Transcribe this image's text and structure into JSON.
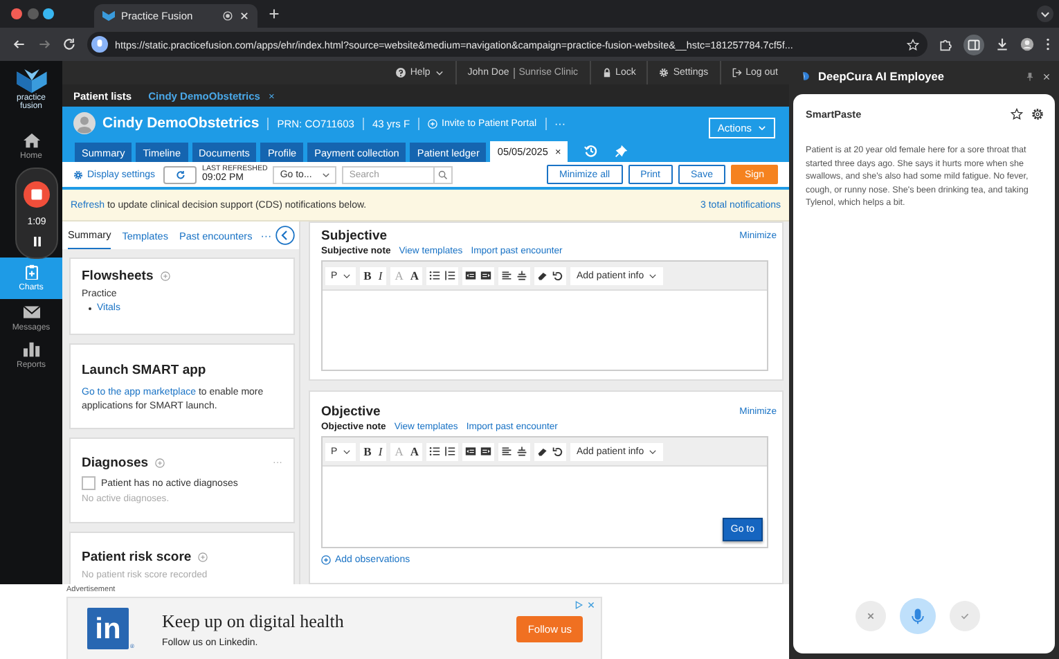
{
  "browser": {
    "tab_title": "Practice Fusion",
    "url": "https://static.practicefusion.com/apps/ehr/index.html?source=website&medium=navigation&campaign=practice-fusion-website&__hstc=181257784.7cf5f..."
  },
  "nav": {
    "logo_text": "practice fusion",
    "items": [
      {
        "label": "Home",
        "selected": false
      },
      {
        "label": "Charts",
        "selected": true
      },
      {
        "label": "Messages",
        "selected": false
      },
      {
        "label": "Reports",
        "selected": false
      }
    ]
  },
  "recorder": {
    "time": "1:09"
  },
  "topbar": {
    "help": "Help",
    "user": "John Doe",
    "clinic": "Sunrise Clinic",
    "lock": "Lock",
    "settings": "Settings",
    "logout": "Log out"
  },
  "patient_tabs": [
    {
      "label": "Patient lists",
      "selected": false
    },
    {
      "label": "Cindy DemoObstetrics",
      "selected": true,
      "close": "×"
    }
  ],
  "patient": {
    "name": "Cindy DemoObstetrics",
    "prn": "PRN: CO711603",
    "age": "43 yrs F",
    "invite": "Invite to Patient Portal",
    "more": "···",
    "actions": "Actions"
  },
  "chart_tabs": [
    {
      "label": "Summary",
      "selected": false
    },
    {
      "label": "Timeline",
      "selected": false
    },
    {
      "label": "Documents",
      "selected": false
    },
    {
      "label": "Profile",
      "selected": false
    },
    {
      "label": "Payment collection",
      "selected": false
    },
    {
      "label": "Patient ledger",
      "selected": false
    },
    {
      "label": "05/05/2025",
      "selected": true,
      "close": "×"
    }
  ],
  "toolbar": {
    "display_settings": "Display settings",
    "last_refreshed_label": "LAST REFRESHED",
    "last_refreshed_time": "09:02 PM",
    "goto": "Go to...",
    "search_placeholder": "Search",
    "buttons": [
      {
        "label": "Minimize all",
        "kind": "outline"
      },
      {
        "label": "Print",
        "kind": "outline"
      },
      {
        "label": "Save",
        "kind": "outline"
      },
      {
        "label": "Sign",
        "kind": "primary"
      }
    ]
  },
  "notification": {
    "link": "Refresh",
    "text": "to update clinical decision support (CDS) notifications below.",
    "count": "3 total notifications"
  },
  "side_tabs": [
    {
      "label": "Summary",
      "selected": true
    },
    {
      "label": "Templates",
      "selected": false
    },
    {
      "label": "Past encounters",
      "selected": false
    }
  ],
  "side_more": "···",
  "cards": [
    {
      "kind": "flowsheets",
      "title": "Flowsheets",
      "subtitle": "Practice",
      "items": [
        "Vitals"
      ]
    },
    {
      "kind": "smart",
      "title": "Launch SMART app",
      "link": "Go to the app marketplace",
      "text": "to enable more applications for SMART launch."
    },
    {
      "kind": "diagnoses",
      "title": "Diagnoses",
      "menu": "···",
      "checkbox": {
        "label": "Patient has no active diagnoses",
        "checked": false
      },
      "note": "No active diagnoses."
    },
    {
      "kind": "risk",
      "title": "Patient risk score",
      "note": "No patient risk score recorded"
    }
  ],
  "sections": [
    {
      "title": "Subjective",
      "minimize": "Minimize",
      "note_label": "Subjective note",
      "links": [
        "View templates",
        "Import past encounter"
      ],
      "editor": {
        "format": "P",
        "bold": "B",
        "italic": "I",
        "font_small": "A",
        "font_large": "A",
        "add_info": "Add patient info"
      }
    },
    {
      "title": "Objective",
      "minimize": "Minimize",
      "note_label": "Objective note",
      "links": [
        "View templates",
        "Import past encounter"
      ],
      "editor": {
        "format": "P",
        "bold": "B",
        "italic": "I",
        "font_small": "A",
        "font_large": "A",
        "add_info": "Add patient info"
      },
      "goto": "Go to"
    }
  ],
  "add_observations": "Add observations",
  "ad": {
    "label": "Advertisement",
    "logo": "in",
    "logo_mark": "®",
    "headline": "Keep up on digital health",
    "subline": "Follow us on Linkedin.",
    "button": "Follow us"
  },
  "assistant": {
    "title": "DeepCura AI Employee",
    "panel_title": "SmartPaste",
    "text": "Patient is at 20 year old female here for a sore throat that started three days ago. She says it hurts more when she swallows, and she's also had some mild fatigue. No fever, cough, or runny nose. She's been drinking tea, and taking Tylenol, which helps a bit.",
    "recording": true
  }
}
